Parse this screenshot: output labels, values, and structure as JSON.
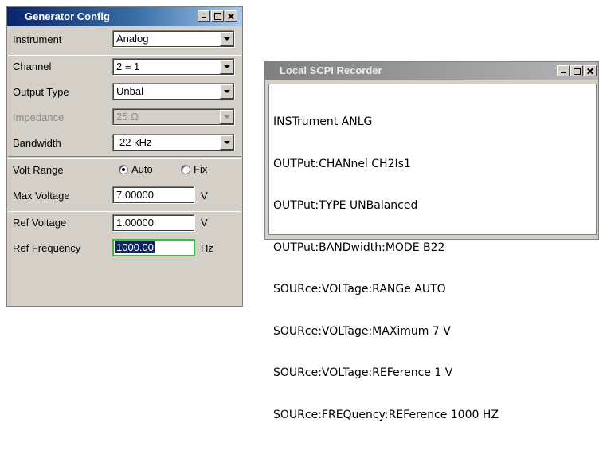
{
  "generator": {
    "title": "Generator Config",
    "instrument": {
      "label": "Instrument",
      "value": "Analog"
    },
    "channel": {
      "label": "Channel",
      "value": "2 ≡ 1"
    },
    "output_type": {
      "label": "Output Type",
      "value": "Unbal"
    },
    "impedance": {
      "label": "Impedance",
      "value": "25 Ω"
    },
    "bandwidth": {
      "label": "Bandwidth",
      "value": "22 kHz"
    },
    "volt_range": {
      "label": "Volt Range",
      "options": [
        "Auto",
        "Fix"
      ],
      "selected": "Auto"
    },
    "max_voltage": {
      "label": "Max Voltage",
      "value": "7.00000",
      "unit": "V"
    },
    "ref_voltage": {
      "label": "Ref Voltage",
      "value": "1.00000",
      "unit": "V"
    },
    "ref_frequency": {
      "label": "Ref Frequency",
      "value": "1000.00",
      "unit": "Hz"
    }
  },
  "recorder": {
    "title": "Local SCPI Recorder",
    "lines": [
      "INSTrument ANLG",
      "OUTPut:CHANnel CH2Is1",
      "OUTPut:TYPE UNBalanced",
      "OUTPut:BANDwidth:MODE B22",
      "SOURce:VOLTage:RANGe AUTO",
      "SOURce:VOLTage:MAXimum 7 V",
      "SOURce:VOLTage:REFerence 1 V",
      "SOURce:FREQuency:REFerence 1000 HZ"
    ]
  },
  "icons": [
    "minimize-icon",
    "maximize-icon",
    "close-icon",
    "dropdown-arrow-icon",
    "radio-icon"
  ]
}
